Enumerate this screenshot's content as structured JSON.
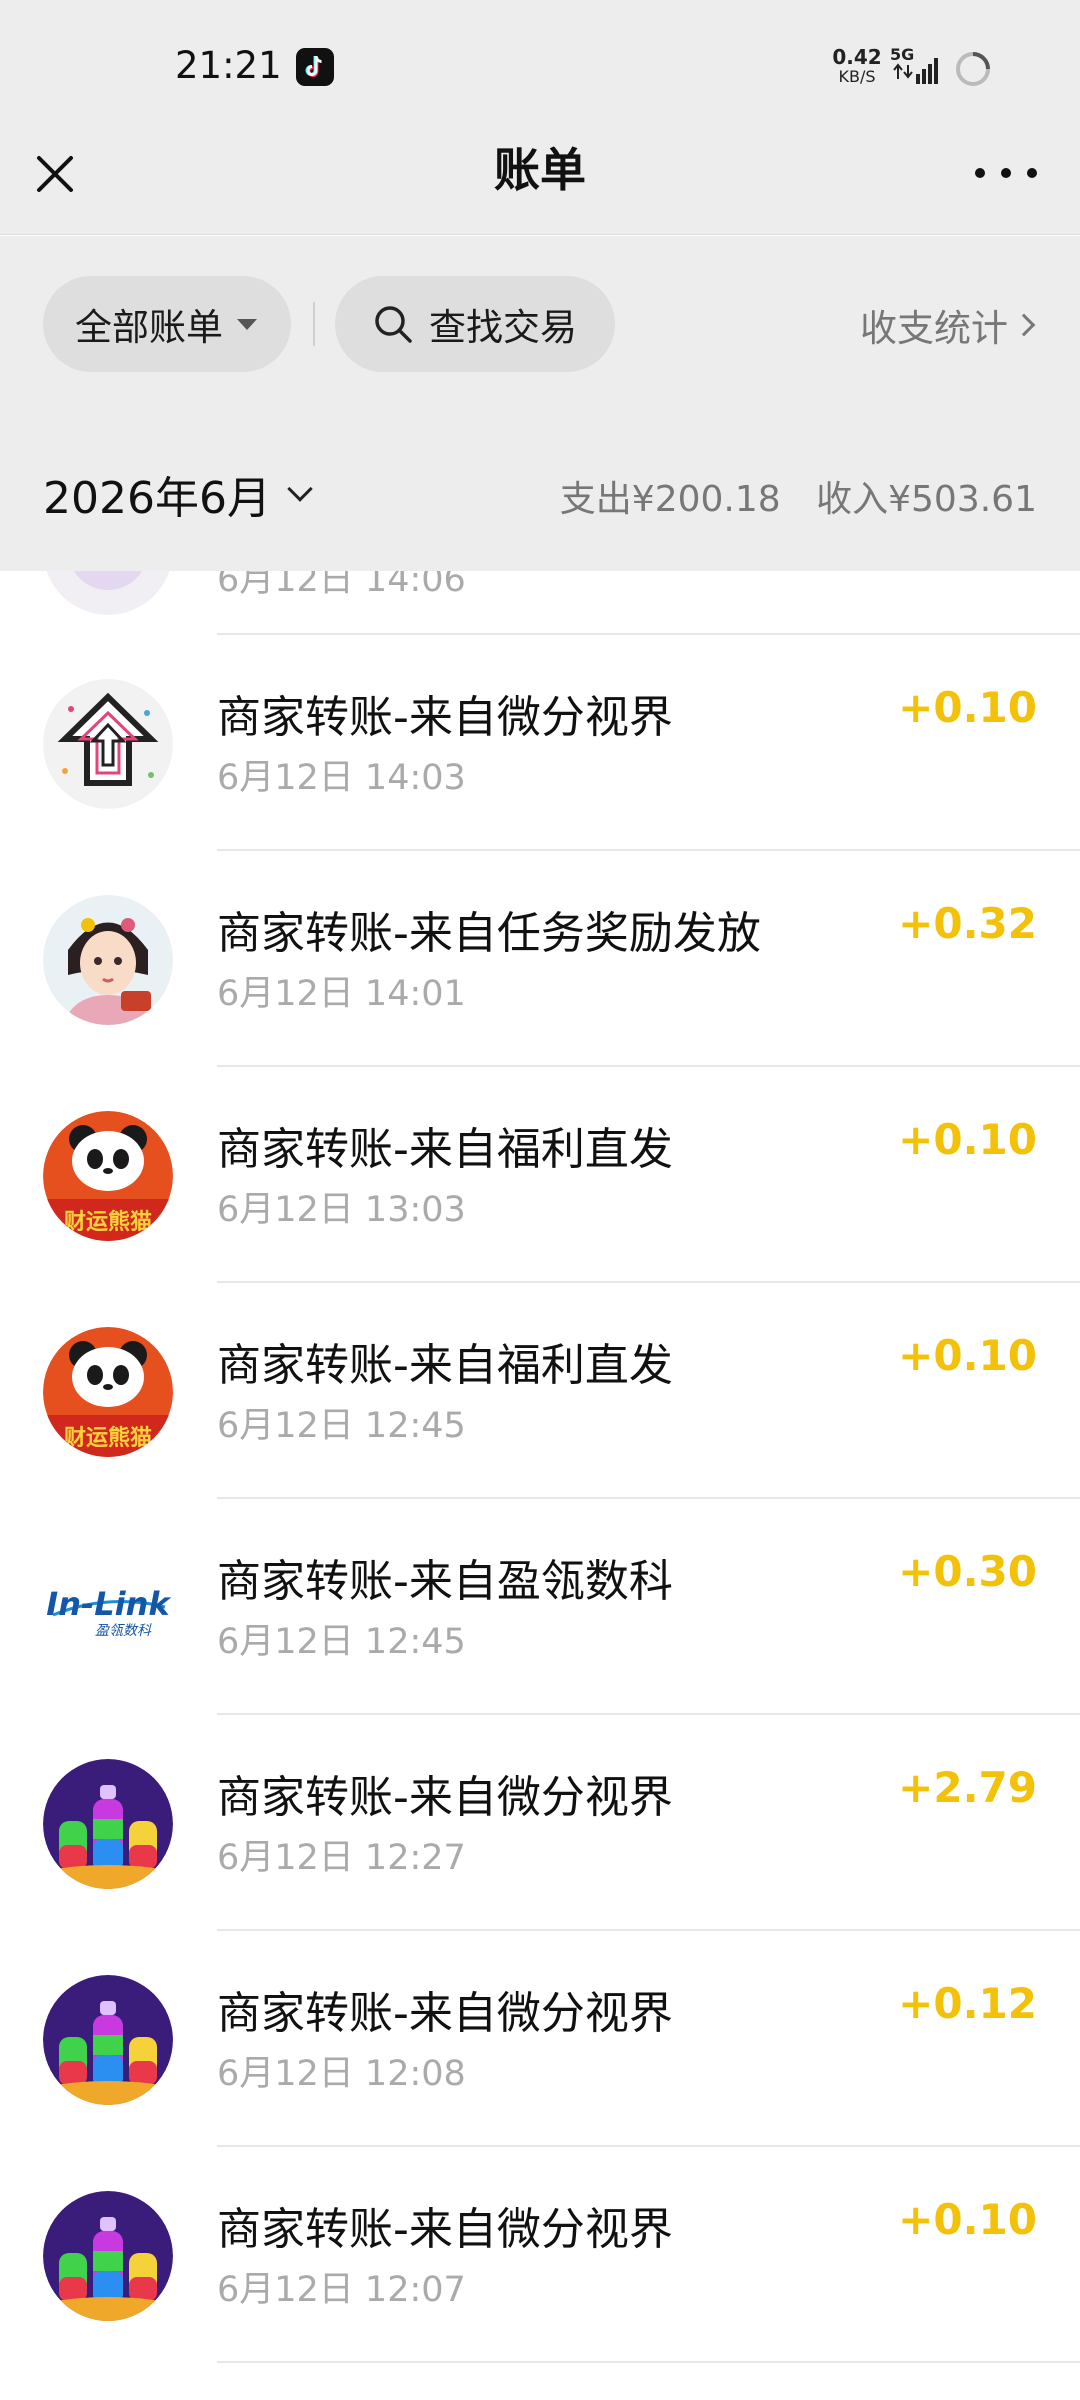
{
  "status_bar": {
    "time": "21:21",
    "speed_value": "0.42",
    "speed_unit": "KB/S",
    "network": "5G"
  },
  "nav": {
    "title": "账单"
  },
  "filters": {
    "all_bills": "全部账单",
    "search": "查找交易",
    "stats": "收支统计"
  },
  "month": {
    "label": "2026年6月",
    "expense": "支出¥200.18",
    "income": "收入¥503.61"
  },
  "transactions": [
    {
      "title": "",
      "time": "6月12日 14:06",
      "amount": "",
      "icon": "partial-avatar"
    },
    {
      "title": "商家转账-来自微分视界",
      "time": "6月12日 14:03",
      "amount": "+0.10",
      "icon": "arrow-logo"
    },
    {
      "title": "商家转账-来自任务奖励发放",
      "time": "6月12日 14:01",
      "amount": "+0.32",
      "icon": "lady-avatar"
    },
    {
      "title": "商家转账-来自福利直发",
      "time": "6月12日 13:03",
      "amount": "+0.10",
      "icon": "panda-avatar"
    },
    {
      "title": "商家转账-来自福利直发",
      "time": "6月12日 12:45",
      "amount": "+0.10",
      "icon": "panda-avatar"
    },
    {
      "title": "商家转账-来自盈瓴数科",
      "time": "6月12日 12:45",
      "amount": "+0.30",
      "icon": "inlink-logo"
    },
    {
      "title": "商家转账-来自微分视界",
      "time": "6月12日 12:27",
      "amount": "+2.79",
      "icon": "bottles-avatar"
    },
    {
      "title": "商家转账-来自微分视界",
      "time": "6月12日 12:08",
      "amount": "+0.12",
      "icon": "bottles-avatar"
    },
    {
      "title": "商家转账-来自微分视界",
      "time": "6月12日 12:07",
      "amount": "+0.10",
      "icon": "bottles-avatar"
    }
  ],
  "colors": {
    "amount": "#f3c107",
    "header_bg": "#ededed",
    "pill_bg": "#dedede"
  },
  "avatar_text": {
    "inlink_main": "In-Link",
    "inlink_sub": "盈瓴数科",
    "panda_banner": "财运熊猫"
  }
}
